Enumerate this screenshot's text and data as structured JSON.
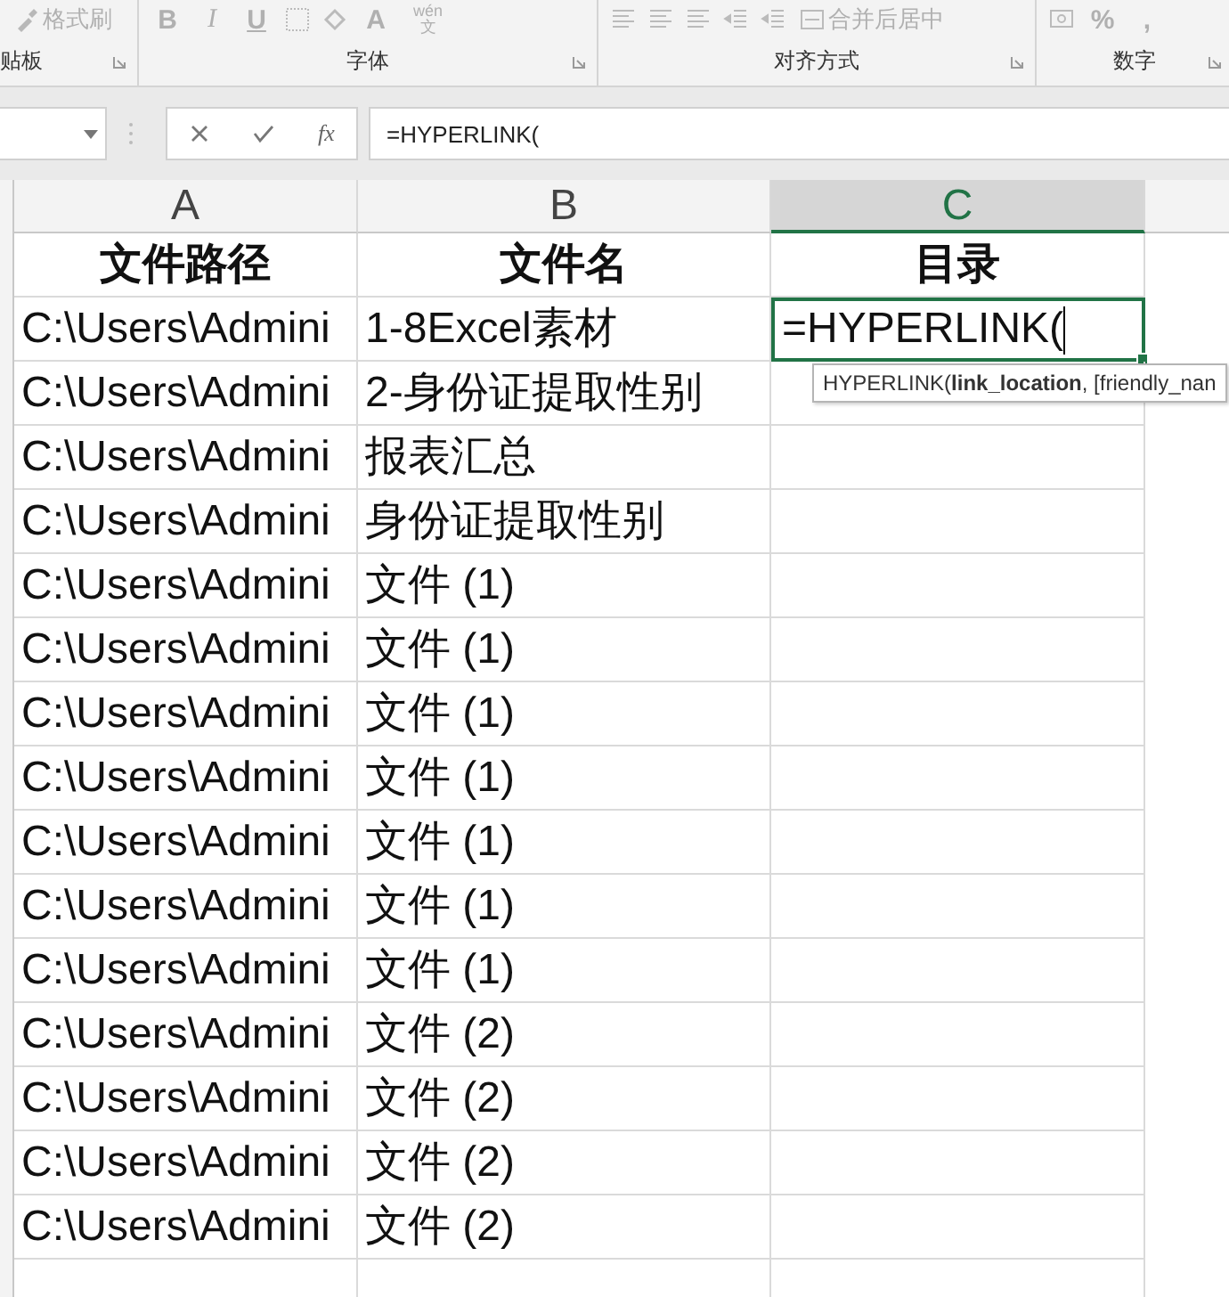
{
  "ribbon": {
    "groups": [
      {
        "label": "贴板",
        "buttons": [
          {
            "kind": "brush",
            "label": "格式刷"
          }
        ]
      },
      {
        "label": "字体",
        "buttons": [
          {
            "kind": "text",
            "label": "B"
          },
          {
            "kind": "italic",
            "label": "I"
          },
          {
            "kind": "underline",
            "label": "U"
          },
          {
            "kind": "border"
          },
          {
            "kind": "fill"
          },
          {
            "kind": "text",
            "label": "A"
          },
          {
            "kind": "phonetic",
            "top": "wén",
            "label": "文"
          }
        ]
      },
      {
        "label": "对齐方式",
        "buttons": [
          {
            "kind": "align"
          },
          {
            "kind": "align"
          },
          {
            "kind": "align"
          },
          {
            "kind": "indent"
          },
          {
            "kind": "indent"
          },
          {
            "kind": "merge",
            "label": "合并后居中"
          }
        ]
      },
      {
        "label": "数字",
        "buttons": [
          {
            "kind": "currency"
          },
          {
            "kind": "text",
            "label": "%"
          },
          {
            "kind": "text",
            "label": ","
          }
        ]
      }
    ]
  },
  "formula_bar": {
    "value": "=HYPERLINK(",
    "fx": "fx"
  },
  "columns": [
    {
      "label": "A",
      "selected": false
    },
    {
      "label": "B",
      "selected": false
    },
    {
      "label": "C",
      "selected": true
    }
  ],
  "rows": [
    {
      "cells": [
        "文件路径",
        "文件名",
        "目录"
      ],
      "kind": "header"
    },
    {
      "cells": [
        "C:\\Users\\Admini",
        "1-8Excel素材"
      ],
      "active_cell": {
        "value": "=HYPERLINK("
      }
    },
    {
      "cells": [
        "C:\\Users\\Admini",
        "2-身份证提取性别"
      ]
    },
    {
      "cells": [
        "C:\\Users\\Admini",
        "报表汇总"
      ]
    },
    {
      "cells": [
        "C:\\Users\\Admini",
        "身份证提取性别"
      ]
    },
    {
      "cells": [
        "C:\\Users\\Admini",
        "文件 (1)"
      ]
    },
    {
      "cells": [
        "C:\\Users\\Admini",
        "文件 (1)"
      ]
    },
    {
      "cells": [
        "C:\\Users\\Admini",
        "文件 (1)"
      ]
    },
    {
      "cells": [
        "C:\\Users\\Admini",
        "文件 (1)"
      ]
    },
    {
      "cells": [
        "C:\\Users\\Admini",
        "文件 (1)"
      ]
    },
    {
      "cells": [
        "C:\\Users\\Admini",
        "文件 (1)"
      ]
    },
    {
      "cells": [
        "C:\\Users\\Admini",
        "文件 (1)"
      ]
    },
    {
      "cells": [
        "C:\\Users\\Admini",
        "文件 (2)"
      ]
    },
    {
      "cells": [
        "C:\\Users\\Admini",
        "文件 (2)"
      ]
    },
    {
      "cells": [
        "C:\\Users\\Admini",
        "文件 (2)"
      ]
    },
    {
      "cells": [
        "C:\\Users\\Admini",
        "文件 (2)"
      ]
    }
  ],
  "tooltip": {
    "fn": "HYPERLINK(",
    "arg": "link_location",
    "rest": ", [friendly_nan"
  }
}
